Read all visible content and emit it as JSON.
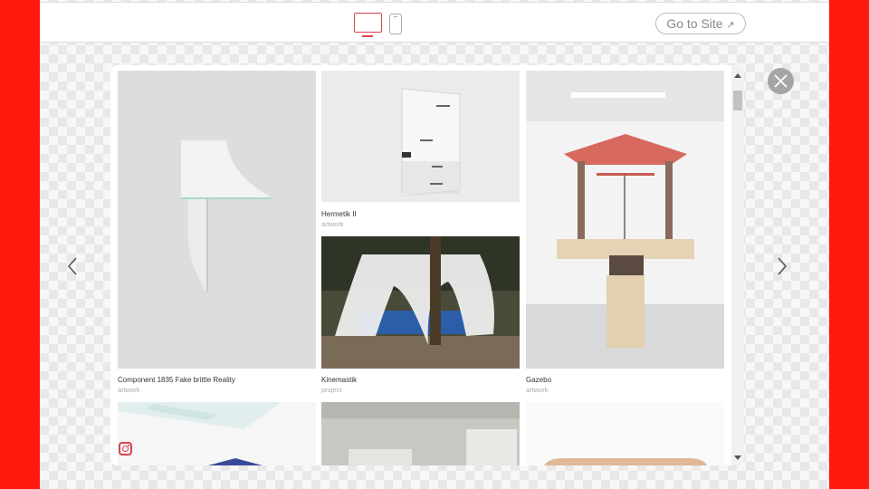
{
  "topbar": {
    "devices": [
      {
        "name": "desktop",
        "icon": "desktop-icon",
        "active": true
      },
      {
        "name": "mobile",
        "icon": "mobile-icon",
        "active": false
      }
    ],
    "goto_label": "Go to Site",
    "goto_arrow": "↗"
  },
  "colors": {
    "accent": "#d9434a",
    "outer_background": "#ff1a10"
  },
  "gallery": {
    "items": [
      {
        "title": "Component 1835 Fake brittle Reality",
        "type": "artwork"
      },
      {
        "title": "Hermetik II",
        "type": "artwork"
      },
      {
        "title": "Kinemastik",
        "type": "project"
      },
      {
        "title": "Gazebo",
        "type": "artwork"
      }
    ]
  },
  "nav": {
    "prev_icon": "chevron-left-icon",
    "next_icon": "chevron-right-icon",
    "close_icon": "close-icon"
  },
  "social": {
    "icon": "instagram-icon"
  }
}
